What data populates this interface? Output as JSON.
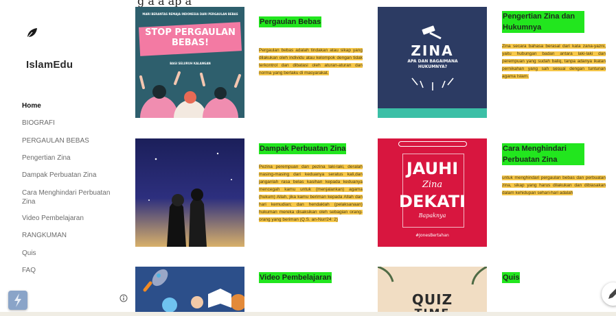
{
  "header": {
    "caption": "g a a ap a"
  },
  "site": {
    "title": "IslamEdu"
  },
  "nav": [
    {
      "label": "Home",
      "active": true
    },
    {
      "label": "BIOGRAFI",
      "active": false
    },
    {
      "label": "PERGAULAN BEBAS",
      "active": false
    },
    {
      "label": "Pengertian Zina",
      "active": false
    },
    {
      "label": "Dampak Perbuatan Zina",
      "active": false
    },
    {
      "label": "Cara Menghindari Perbuatan Zina",
      "active": false
    },
    {
      "label": "Video Pembelajaran",
      "active": false
    },
    {
      "label": "RANGKUMAN",
      "active": false
    },
    {
      "label": "Quis",
      "active": false
    },
    {
      "label": "FAQ",
      "active": false
    }
  ],
  "cards": [
    {
      "title": "Pergaulan Bebas",
      "text": "Pergaulan bebas adalah tindakan atau sikap yang dilakukan oleh individu atau kelompok dengan tidak terkontrol dan dibatasi oleh aturan-aturan dan norma yang berlaku di masyarakat.",
      "image": {
        "top_caption": "MARI BERANTAS REMAJA INDONESIA DARI PERGAULAN BEBAS",
        "headline": "STOP PERGAULAN BEBAS!",
        "byline": "BAGI SELURUH KALANGAN"
      }
    },
    {
      "title": "Pengertian Zina dan Hukumnya",
      "text": "Zina secara bahasa berasal dari kata zana-yazni, yaitu hubungan badan antara laki-laki dan perempuan yang sudah baliq, tanpa adanya ikatan pernikahan yang sah sesuai dengan tuntunan agama Islam.",
      "image": {
        "headline": "ZINA",
        "sub": "APA DAN BAGAIMANA HUKUMNYA?"
      }
    },
    {
      "title": "Dampak Perbuatan Zina",
      "text": "Pezina perempuan dan pezina laki-laki, deralah masing-masing dari keduanya seratus kali,dan janganlah rasa belas kasihan kepada keduanya mencegah kamu untuk (menjalankan) agama (hukum) Allah, jika kamu beriman kepada Allah dan hari kemudian; dan hendaklah (pelaksanaan) hukuman mereka disaksikan oleh sebagian orang-orang yang beriman (Q.S. an-Nur/24: 2)",
      "image": {}
    },
    {
      "title": "Cara Menghindari Perbuatan Zina",
      "text": "untuk menghindari pergaulan bebas dan perbuatan zina, sikap yang harus dilakukan dan dibiasakan dalam kehidupan sehari-hari adalah",
      "image": {
        "line1": "JAUHI",
        "line2": "Zina",
        "line3": "DEKATI",
        "line4": "Bapaknya",
        "tag": "#JonesBertahan"
      }
    },
    {
      "title": "Video Pembelajaran",
      "text": "",
      "image": {}
    },
    {
      "title": "Quis",
      "text": "",
      "image": {
        "headline": "QUIZ",
        "sub": "TIME"
      }
    }
  ],
  "colors": {
    "title_highlight": "#22e61e",
    "text_highlight": "#f7c84a",
    "stop_bg": "#2e5f6d",
    "zina_bg": "#2c3b63",
    "jauhi_bg": "#d8163f"
  },
  "icons": [
    "leaf-icon",
    "info-icon",
    "lightning-icon",
    "pencil-icon"
  ]
}
